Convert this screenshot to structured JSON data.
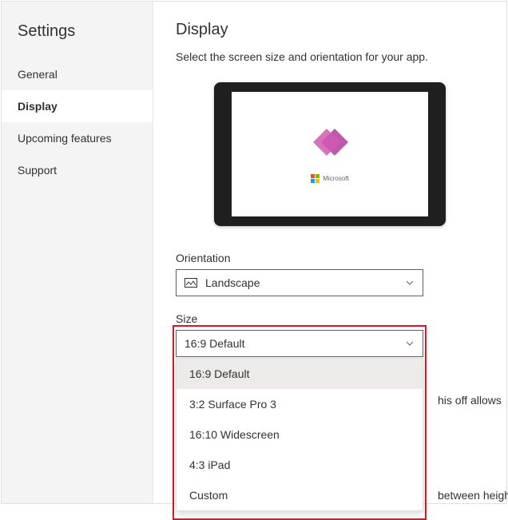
{
  "sidebar": {
    "title": "Settings",
    "items": [
      {
        "label": "General"
      },
      {
        "label": "Display"
      },
      {
        "label": "Upcoming features"
      },
      {
        "label": "Support"
      }
    ],
    "activeIndex": 1
  },
  "page": {
    "title": "Display",
    "description": "Select the screen size and orientation for your app."
  },
  "preview": {
    "brand": "Microsoft"
  },
  "orientation": {
    "label": "Orientation",
    "value": "Landscape"
  },
  "size": {
    "label": "Size",
    "value": "16:9 Default",
    "options": [
      "16:9 Default",
      "3:2 Surface Pro 3",
      "16:10 Widescreen",
      "4:3 iPad",
      "Custom"
    ],
    "selectedIndex": 0
  },
  "obscured": {
    "fragment1": "his off allows",
    "fragment2": "between height"
  }
}
